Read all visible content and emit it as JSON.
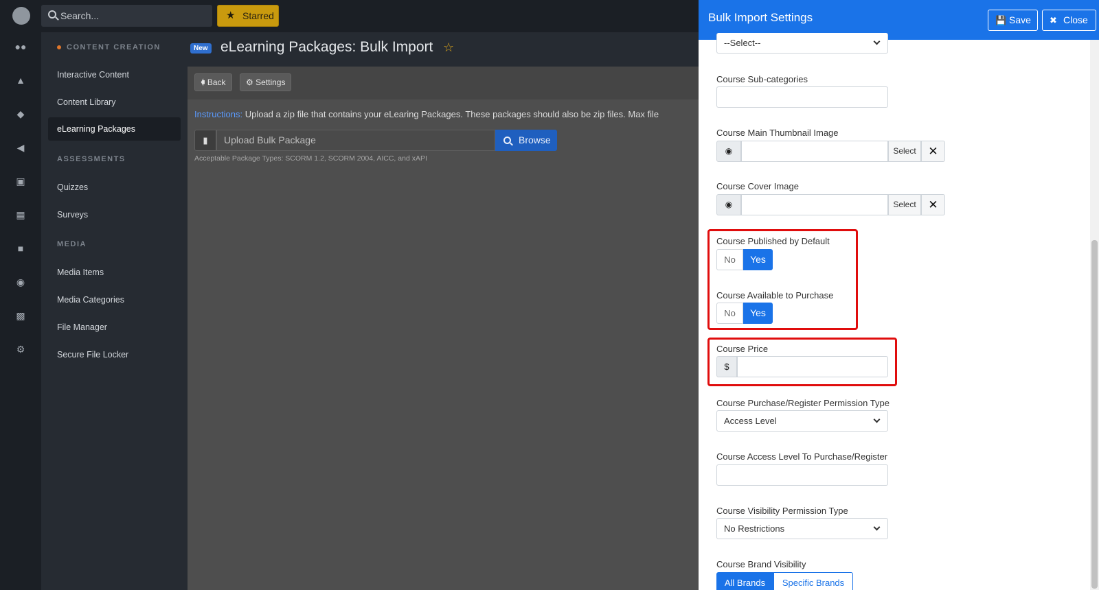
{
  "topbar": {
    "search_placeholder": "Search...",
    "starred_label": "Starred"
  },
  "rail": {
    "icons": [
      "app-logo",
      "users-icon",
      "shapes-icon",
      "graduation-cap-icon",
      "megaphone-icon",
      "ticket-icon",
      "chart-icon",
      "comment-icon",
      "palette-icon",
      "calendar-icon",
      "gear-icon"
    ]
  },
  "sidebar": {
    "sections": [
      {
        "title": "CONTENT CREATION",
        "items": [
          "Interactive Content",
          "Content Library",
          "eLearning Packages"
        ]
      },
      {
        "title": "ASSESSMENTS",
        "items": [
          "Quizzes",
          "Surveys"
        ]
      },
      {
        "title": "MEDIA",
        "items": [
          "Media Items",
          "Media Categories",
          "File Manager",
          "Secure File Locker"
        ]
      }
    ],
    "active_item": "eLearning Packages"
  },
  "main": {
    "badge": "New",
    "title": "eLearning Packages: Bulk Import",
    "toolbar": {
      "back_label": "Back",
      "settings_label": "Settings"
    },
    "instructions_label": "Instructions:",
    "instructions_text": " Upload a zip file that contains your eLearing Packages. These packages should also be zip files. Max file",
    "upload_placeholder": "Upload Bulk Package",
    "browse_label": "Browse",
    "hint": "Acceptable Package Types: SCORM 1.2, SCORM 2004, AICC, and xAPI"
  },
  "drawer": {
    "title": "Bulk Import Settings",
    "save_label": "Save",
    "close_label": "Close",
    "category_select_value": "--Select--",
    "subcategories_label": "Course Sub-categories",
    "thumbnail_label": "Course Main Thumbnail Image",
    "cover_label": "Course Cover Image",
    "select_button_label": "Select",
    "published_label": "Course Published by Default",
    "available_label": "Course Available to Purchase",
    "no_label": "No",
    "yes_label": "Yes",
    "price_label": "Course Price",
    "currency_symbol": "$",
    "purchase_permission_label": "Course Purchase/Register Permission Type",
    "purchase_permission_value": "Access Level",
    "access_level_label": "Course Access Level To Purchase/Register",
    "visibility_label": "Course Visibility Permission Type",
    "visibility_value": "No Restrictions",
    "brand_label": "Course Brand Visibility",
    "all_brands_label": "All Brands",
    "specific_brands_label": "Specific Brands"
  },
  "colors": {
    "accent": "#1a73e8",
    "highlight": "#e00d0d",
    "starred": "#c99a0e"
  }
}
